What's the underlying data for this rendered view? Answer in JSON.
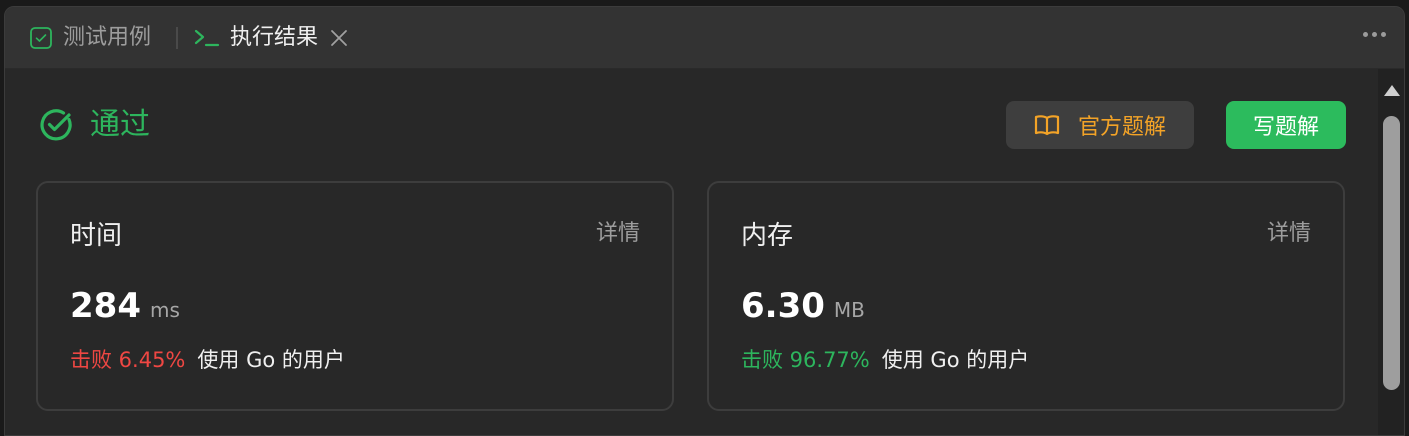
{
  "tabs": {
    "testcases": {
      "label": "测试用例",
      "icon": "checkbox-icon"
    },
    "results": {
      "label": "执行结果",
      "icon": "terminal-icon",
      "active": true
    }
  },
  "more_icon": "more-horizontal-icon",
  "result": {
    "status": "通过",
    "status_color": "#2db55d",
    "status_icon": "check-circle-icon"
  },
  "buttons": {
    "official_solution": "官方题解",
    "official_solution_icon": "book-icon",
    "official_color": "#f3a327",
    "write_solution": "写题解",
    "write_color": "#2cbb5d"
  },
  "time": {
    "title": "时间",
    "detail": "详情",
    "value": "284",
    "unit": "ms",
    "beats_prefix": "击败 6.45%",
    "beats_color": "#ef4743",
    "beats_suffix": "使用 Go 的用户"
  },
  "memory": {
    "title": "内存",
    "detail": "详情",
    "value": "6.30",
    "unit": "MB",
    "beats_prefix": "击败 96.77%",
    "beats_color": "#2db55d",
    "beats_suffix": "使用 Go 的用户"
  }
}
